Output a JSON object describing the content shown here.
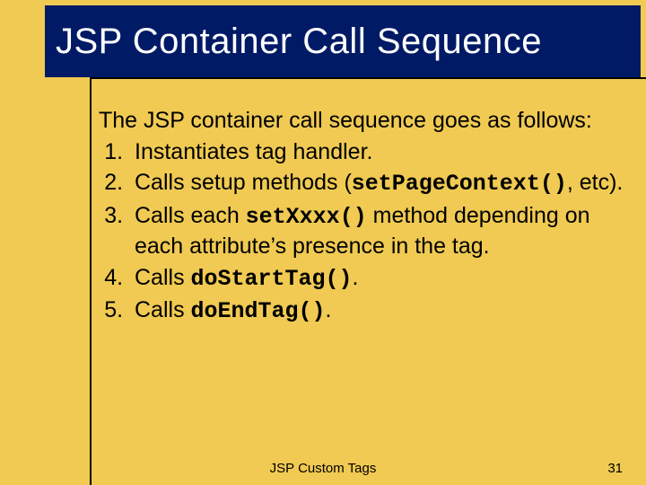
{
  "title": "JSP Container Call Sequence",
  "intro": "The JSP container call sequence goes as follows:",
  "items": {
    "i1": "Instantiates tag handler.",
    "i2_pre": "Calls setup methods (",
    "i2_code": "setPageContext()",
    "i2_post": ", etc).",
    "i3_pre": "Calls each ",
    "i3_code": "setXxxx()",
    "i3_post": " method depending on each attribute’s presence in the tag.",
    "i4_pre": "Calls ",
    "i4_code": "doStartTag()",
    "i4_post": ".",
    "i5_pre": "Calls ",
    "i5_code": "doEndTag()",
    "i5_post": "."
  },
  "footer": {
    "center": "JSP Custom Tags",
    "page": "31"
  }
}
